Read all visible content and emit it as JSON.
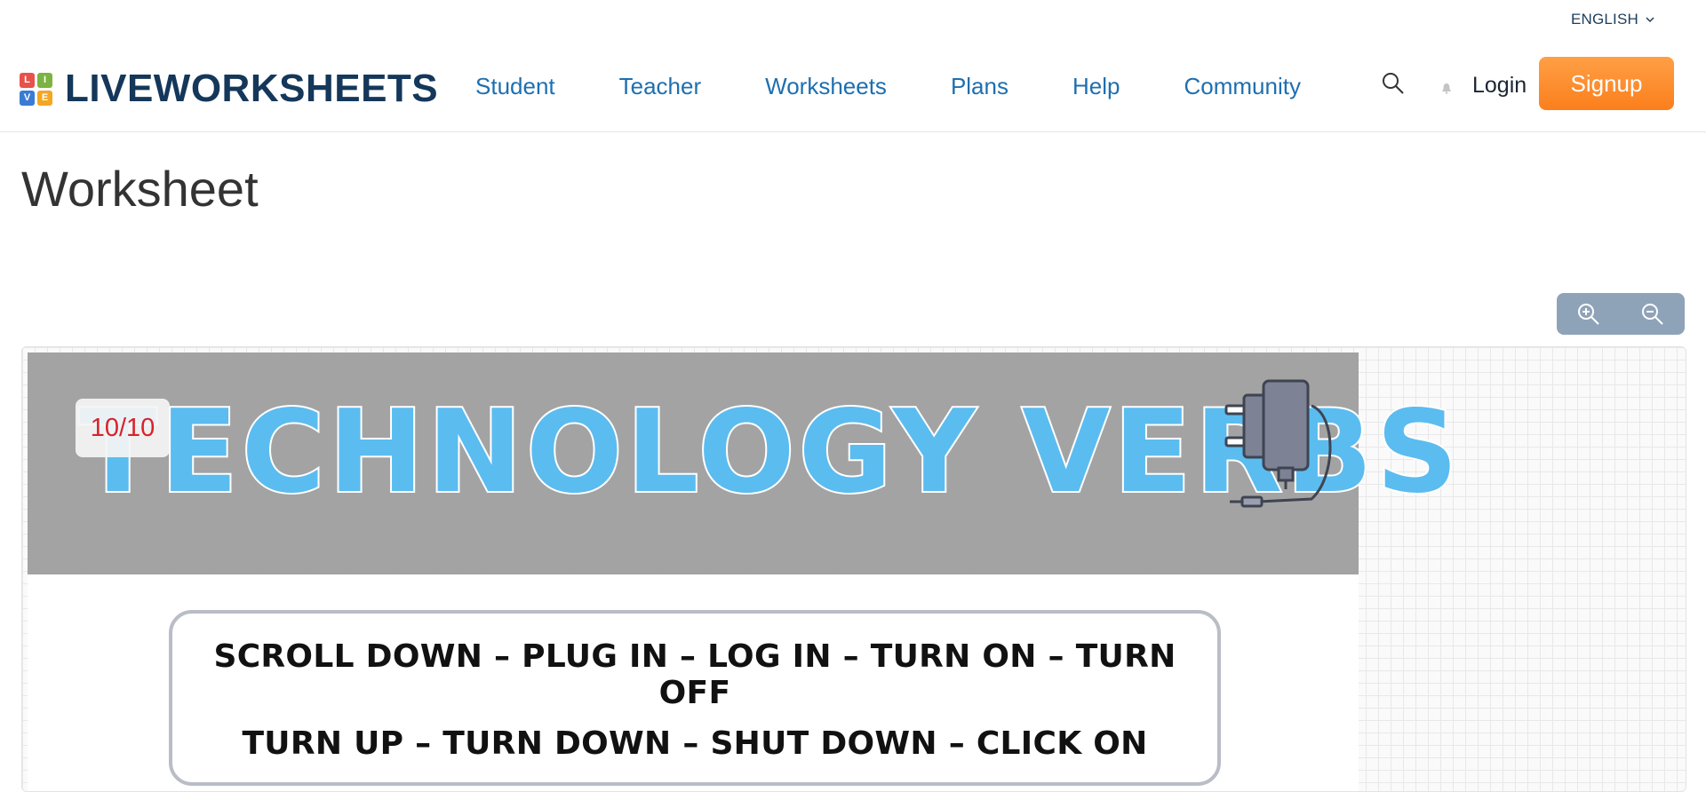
{
  "language": {
    "label": "ENGLISH"
  },
  "logo": {
    "letters": [
      "L",
      "I",
      "V",
      "E"
    ],
    "text": "LIVEWORKSHEETS",
    "colors": [
      "#e8524a",
      "#7cb342",
      "#3a7bd5",
      "#f5a623"
    ]
  },
  "nav": {
    "items": [
      "Student",
      "Teacher",
      "Worksheets",
      "Plans",
      "Help",
      "Community"
    ]
  },
  "auth": {
    "login": "Login",
    "signup": "Signup"
  },
  "page": {
    "title": "Worksheet"
  },
  "zoom": {
    "in_icon": "zoom-in-icon",
    "out_icon": "zoom-out-icon"
  },
  "worksheet": {
    "banner_title": "TECHNOLOGY VERBS",
    "score": "10/10",
    "verb_lines": [
      "SCROLL DOWN – PLUG IN – LOG IN – TURN ON – TURN OFF",
      "TURN UP – TURN DOWN – SHUT DOWN – CLICK ON"
    ]
  },
  "colors": {
    "brand": "#14375a",
    "nav": "#1e6fb0",
    "signup": "#fb8a2b",
    "banner_bg": "#a3a3a3",
    "banner_text": "#5bbcf0",
    "score": "#d8232a"
  }
}
